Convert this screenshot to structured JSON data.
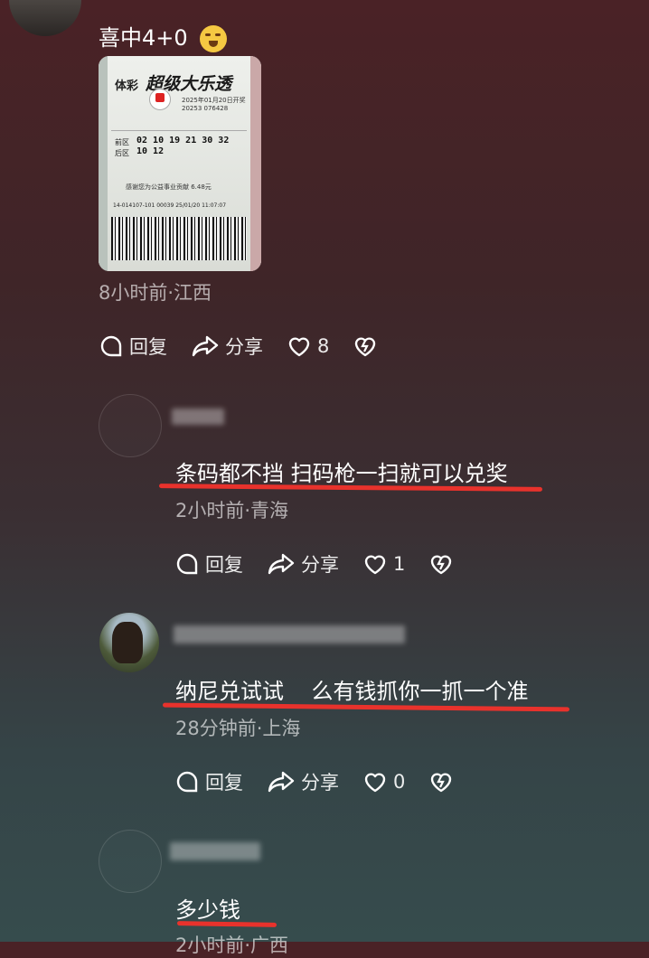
{
  "comments": [
    {
      "text": "喜中4+0",
      "emoji": "laughing-emoji",
      "ticket": {
        "brand": "体彩",
        "title": "超级大乐透",
        "front_area": "前区",
        "back_area": "后区",
        "front_numbers": "02 10 19 21 30 32",
        "back_numbers": "10 12",
        "date_line": "2025年01月20日开奖",
        "serial": "20253 076428",
        "footer": "感谢您为公益事业贡献 6.48元",
        "code": "14-014107-101 00039 25/01/20 11:07:07"
      },
      "meta": "8小时前·江西",
      "reply": "回复",
      "share": "分享",
      "likes": "8"
    },
    {
      "text": "条码都不挡 扫码枪一扫就可以兑奖",
      "meta": "2小时前·青海",
      "reply": "回复",
      "share": "分享",
      "likes": "1"
    },
    {
      "text": "纳尼兑试试    么有钱抓你一抓一个准",
      "meta": "28分钟前·上海",
      "reply": "回复",
      "share": "分享",
      "likes": "0"
    },
    {
      "text": "多少钱",
      "meta": "2小时前·广西"
    }
  ],
  "colors": {
    "underline": "#e8322c",
    "meta": "#a8a0a2"
  },
  "icons": [
    "reply-icon",
    "share-icon",
    "heart-icon",
    "dislike-icon"
  ]
}
